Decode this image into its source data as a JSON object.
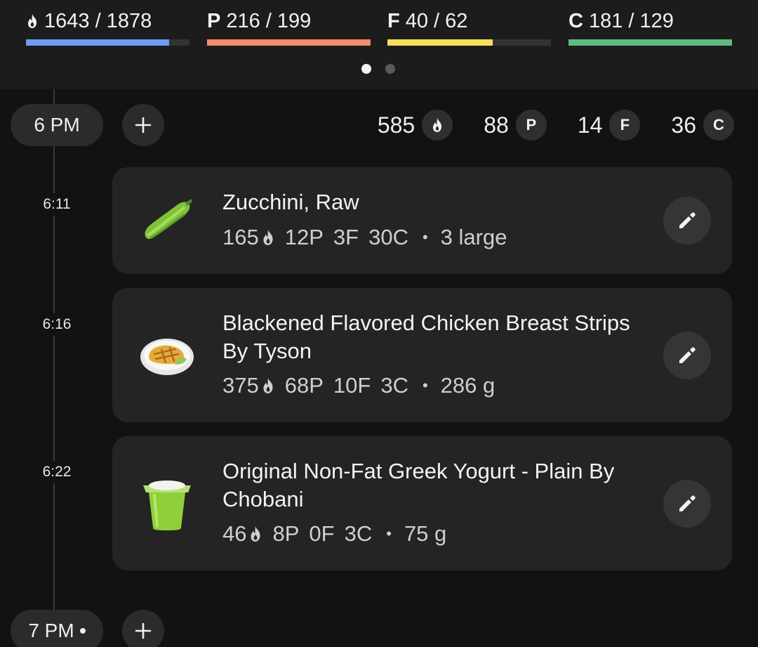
{
  "header": {
    "macros": [
      {
        "key": "calories",
        "icon": "flame-icon",
        "prefix": "",
        "label": "1643 / 1878",
        "progress": 0.875,
        "color": "#6e9cf2"
      },
      {
        "key": "protein",
        "prefix": "P",
        "label": "216 / 199",
        "progress": 1.0,
        "color": "#f58a6c"
      },
      {
        "key": "fat",
        "prefix": "F",
        "label": "40 / 62",
        "progress": 0.645,
        "color": "#f5e15a"
      },
      {
        "key": "carbs",
        "prefix": "C",
        "label": "181 / 129",
        "progress": 1.0,
        "color": "#5dbb7f"
      }
    ],
    "page_dots": {
      "count": 2,
      "active": 0
    }
  },
  "timeline": {
    "groups": [
      {
        "hour": "6 PM",
        "totals": {
          "calories": "585",
          "protein": "88",
          "fat": "14",
          "carbs": "36"
        },
        "badges": {
          "protein": "P",
          "fat": "F",
          "carbs": "C"
        }
      },
      {
        "hour": "7 PM",
        "current": true
      }
    ],
    "entries": [
      {
        "time": "6:11",
        "icon": "zucchini-icon",
        "name": "Zucchini, Raw",
        "calories": "165",
        "protein": "12P",
        "fat": "3F",
        "carbs": "30C",
        "serving": "3 large"
      },
      {
        "time": "6:16",
        "icon": "chicken-plate-icon",
        "name": "Blackened Flavored Chicken Breast Strips By Tyson",
        "calories": "375",
        "protein": "68P",
        "fat": "10F",
        "carbs": "3C",
        "serving": "286 g"
      },
      {
        "time": "6:22",
        "icon": "yogurt-cup-icon",
        "name": "Original Non-Fat Greek Yogurt - Plain By Chobani",
        "calories": "46",
        "protein": "8P",
        "fat": "0F",
        "carbs": "3C",
        "serving": "75 g"
      }
    ],
    "bullet": "•"
  }
}
